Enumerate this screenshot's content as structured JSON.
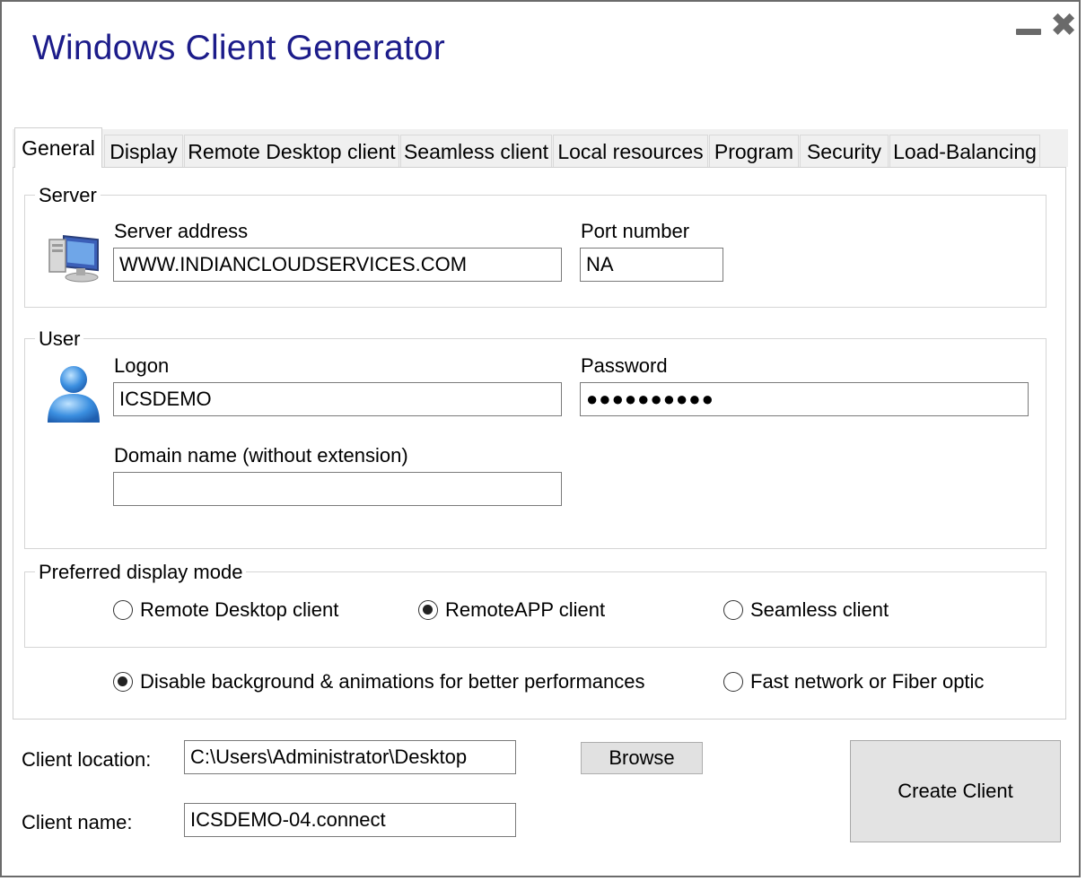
{
  "window": {
    "title": "Windows Client Generator",
    "minimize_icon": "minimize-icon",
    "close_icon": "close-icon"
  },
  "tabs": [
    {
      "label": "General",
      "active": true
    },
    {
      "label": "Display"
    },
    {
      "label": "Remote Desktop client"
    },
    {
      "label": "Seamless client"
    },
    {
      "label": "Local resources"
    },
    {
      "label": "Program"
    },
    {
      "label": "Security"
    },
    {
      "label": "Load-Balancing"
    }
  ],
  "server": {
    "legend": "Server",
    "icon": "computer-icon",
    "address_label": "Server address",
    "address_value": "WWW.INDIANCLOUDSERVICES.COM",
    "port_label": "Port number",
    "port_value": "NA"
  },
  "user": {
    "legend": "User",
    "icon": "user-icon",
    "logon_label": "Logon",
    "logon_value": "ICSDEMO",
    "password_label": "Password",
    "password_value": "●●●●●●●●●●",
    "domain_label": "Domain name (without extension)",
    "domain_value": ""
  },
  "display_mode": {
    "legend": "Preferred display mode",
    "options": [
      {
        "label": "Remote Desktop client",
        "checked": false
      },
      {
        "label": "RemoteAPP client",
        "checked": true
      },
      {
        "label": "Seamless client",
        "checked": false
      }
    ]
  },
  "performance": {
    "options": [
      {
        "label": "Disable background & animations for better performances",
        "checked": true
      },
      {
        "label": "Fast network or Fiber optic",
        "checked": false
      }
    ]
  },
  "bottom": {
    "location_label": "Client location:",
    "location_value": "C:\\Users\\Administrator\\Desktop",
    "browse_label": "Browse",
    "name_label": "Client name:",
    "name_value": "ICSDEMO-04.connect",
    "create_label": "Create Client"
  }
}
